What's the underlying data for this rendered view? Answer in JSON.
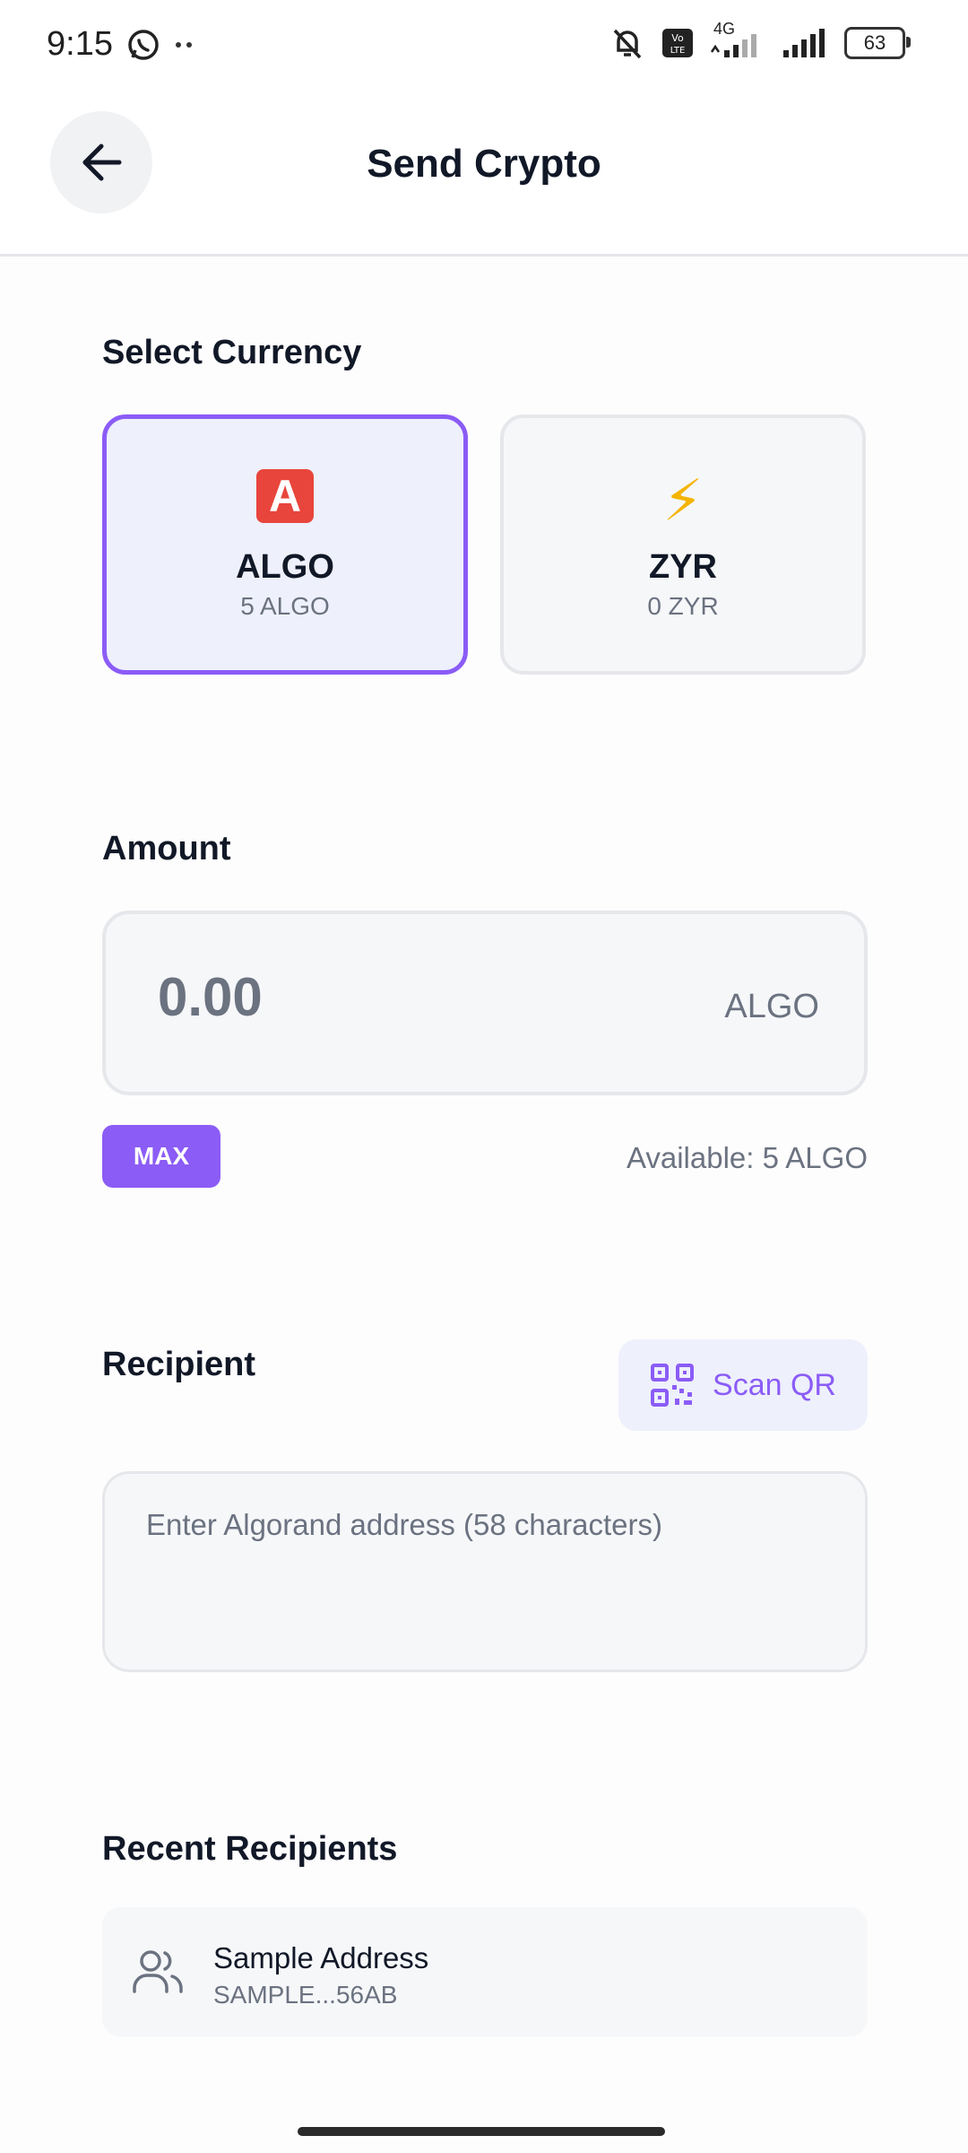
{
  "status_bar": {
    "time": "9:15",
    "battery": "63",
    "network": "4G"
  },
  "header": {
    "title": "Send Crypto"
  },
  "currency": {
    "label": "Select Currency",
    "options": [
      {
        "name": "ALGO",
        "balance": "5 ALGO",
        "icon": "A",
        "icon_name": "algo-letter-a-icon",
        "selected": true
      },
      {
        "name": "ZYR",
        "balance": "0 ZYR",
        "icon": "⚡",
        "icon_name": "lightning-icon",
        "selected": false
      }
    ]
  },
  "amount": {
    "label": "Amount",
    "value": "0.00",
    "unit": "ALGO",
    "max_label": "MAX",
    "available": "Available: 5 ALGO"
  },
  "recipient": {
    "label": "Recipient",
    "scan_label": "Scan QR",
    "placeholder": "Enter Algorand address (58 characters)"
  },
  "recent": {
    "label": "Recent Recipients",
    "items": [
      {
        "name": "Sample Address",
        "address": "SAMPLE...56AB"
      }
    ]
  },
  "colors": {
    "accent": "#8b5cf6",
    "selected_bg": "#eef0fc",
    "muted_text": "#6b7280",
    "text": "#111827"
  }
}
